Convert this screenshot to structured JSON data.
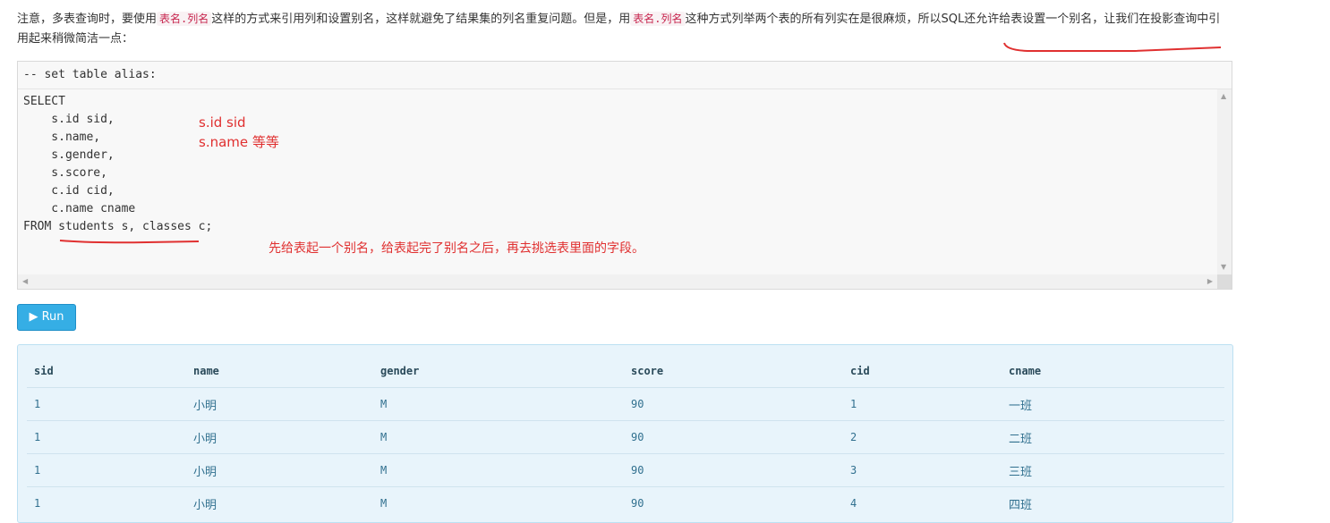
{
  "intro": {
    "p1": "注意，多表查询时，要使用",
    "code1": "表名.列名",
    "p2": "这样的方式来引用列和设置别名，这样就避免了结果集的列名重复问题。但是，用",
    "code2": "表名.列名",
    "p3": "这种方式列举两个表的所有列实在是很麻烦，所以SQL还允许给表设置一个别名，让我们在投影查询中引用起来稍微简洁一点："
  },
  "editor": {
    "header": "-- set table alias:",
    "lines": [
      "SELECT",
      "    s.id sid,",
      "    s.name,",
      "    s.gender,",
      "    s.score,",
      "    c.id cid,",
      "    c.name cname",
      "FROM students s, classes c;"
    ]
  },
  "notes": {
    "note1": "s.id sid",
    "note2": "s.name 等等",
    "note3": "先给表起一个别名，给表起完了别名之后，再去挑选表里面的字段。"
  },
  "run_button": {
    "label": "▶ Run"
  },
  "result": {
    "columns": [
      "sid",
      "name",
      "gender",
      "score",
      "cid",
      "cname"
    ],
    "rows": [
      [
        "1",
        "小明",
        "M",
        "90",
        "1",
        "一班"
      ],
      [
        "1",
        "小明",
        "M",
        "90",
        "2",
        "二班"
      ],
      [
        "1",
        "小明",
        "M",
        "90",
        "3",
        "三班"
      ],
      [
        "1",
        "小明",
        "M",
        "90",
        "4",
        "四班"
      ]
    ]
  },
  "colors": {
    "accent": "#35aee5",
    "annotation": "#e03030",
    "result_bg": "#e8f4fb"
  }
}
